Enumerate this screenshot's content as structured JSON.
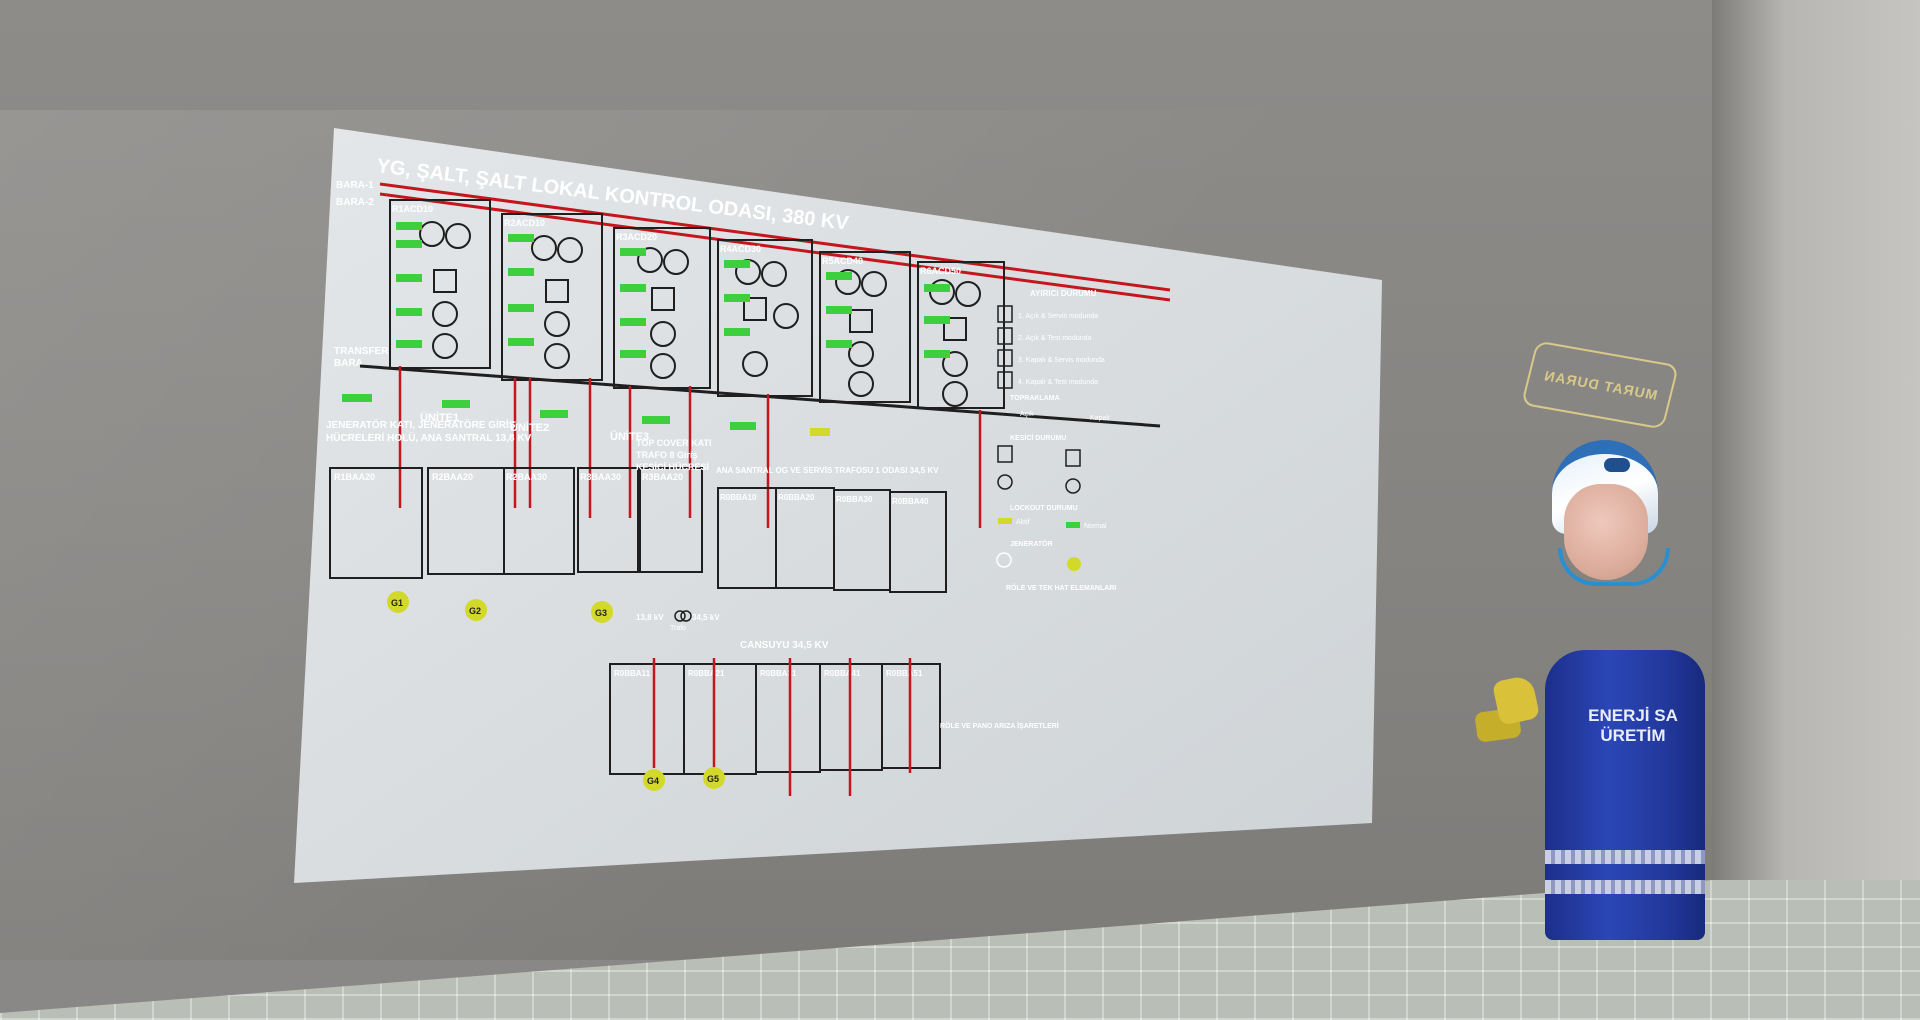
{
  "panel": {
    "title": "YG, ŞALT, ŞALT LOKAL KONTROL ODASI, 380 KV",
    "bus_labels": [
      "BARA-1",
      "BARA-2"
    ],
    "transfer_label_1": "TRANSFER",
    "transfer_label_2": "BARA",
    "unit_labels": [
      "ÜNİTE1",
      "ÜNİTE2",
      "ÜNİTE3"
    ],
    "bay_codes": [
      "R1ACD10",
      "R2ACD10",
      "R3ACD20",
      "R4ACD30",
      "R5ACD40",
      "R6ACD50"
    ],
    "gen_floor_title_1": "JENERATÖR KATI, JENERATÖRE GİRİŞ",
    "gen_floor_title_2": "HÜCRELERİ HOLÜ, ANA SANTRAL 13,8 KV",
    "gen_cells": [
      "R1BAA20",
      "R2BAA20",
      "R2BAA30",
      "R3BAA30",
      "R3BAA20"
    ],
    "top_cover_title_1": "TOP COVER KATI",
    "top_cover_title_2": "TRAFO 8 Giriş",
    "top_cover_title_3": "KESİCİ HÜCRESİ",
    "main_station_title": "ANA SANTRAL OG VE SERVİS TRAFOSU 1 ODASI 34,5 KV",
    "service_cells": [
      "R0BBA10",
      "R0BBA20",
      "R0BBA30",
      "R0BBA40"
    ],
    "transformer_label_left": "13,8 kV",
    "transformer_label_right": "34,5 kV",
    "transformer_caption": "Trafo",
    "cansuyu_title": "CANSUYU 34,5 KV",
    "cansuyu_cells": [
      "R0BBA11",
      "R0BBA21",
      "R0BBA31",
      "R0BBA41",
      "R0BBA51"
    ],
    "generators": [
      "G1",
      "G2",
      "G3",
      "G4",
      "G5"
    ],
    "legend_header": "AYIRICI DURUMU",
    "legend_items": [
      "1. Açık & Servis modunda",
      "2. Açık & Test modunda",
      "3. Kapalı & Servis modunda",
      "4. Kapalı & Test modunda"
    ],
    "legend_section_2": "TOPRAKLAMA",
    "legend_open": "Açık",
    "legend_closed": "Kapalı",
    "legend_section_3": "KESİCİ DURUMU",
    "legend_section_4": "LOCKOUT DURUMU",
    "legend_section_5": "JENERATÖR",
    "legend_section_6": "RÖLE VE TEK HAT ELEMANLARI",
    "legend_section_7": "RÖLE VE PANO ARIZA İŞARETLERİ",
    "legend_lockout_active": "Aktif",
    "legend_lockout_normal": "Normal"
  },
  "badge": {
    "name": "MURAT DURAN"
  },
  "avatar": {
    "shirt_text_1": "ENERJİ SA",
    "shirt_text_2": "ÜRETİM"
  },
  "colors": {
    "panel_bg": "#dfe3e5",
    "red_line": "#c4161c",
    "dark_line": "#1f1f1f",
    "green_tag": "#3ecf3e",
    "gen_yellow": "#d3d92a",
    "badge_gold": "#d8c98a",
    "uniform_blue": "#2b46b6"
  }
}
